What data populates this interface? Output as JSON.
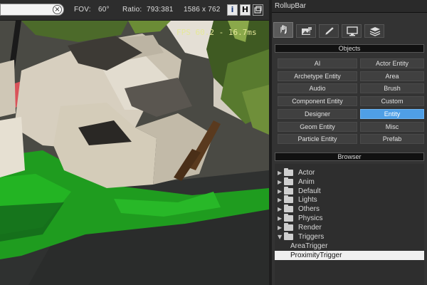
{
  "toolbar": {
    "search_value": "",
    "clear_icon": "×",
    "fov_label": "FOV:",
    "fov_value": "60°",
    "ratio_label": "Ratio:",
    "ratio_value": "793:381",
    "resolution": "1586 x 762",
    "info_button": "i",
    "h_button": "H",
    "icons": [
      "info-icon",
      "h-icon",
      "maximize-icon"
    ]
  },
  "viewport": {
    "fps_text": "FPS 60.2 - 16.7ms"
  },
  "rollup": {
    "title": "RollupBar",
    "tabs": [
      "objects-tab-icon",
      "terrain-tab-icon",
      "modify-tab-icon",
      "display-tab-icon",
      "layers-tab-icon"
    ],
    "objects_header": "Objects",
    "buttons": [
      [
        "AI",
        "Actor Entity"
      ],
      [
        "Archetype Entity",
        "Area"
      ],
      [
        "Audio",
        "Brush"
      ],
      [
        "Component Entity",
        "Custom"
      ],
      [
        "Designer",
        "Entity"
      ],
      [
        "Geom Entity",
        "Misc"
      ],
      [
        "Particle Entity",
        "Prefab"
      ]
    ],
    "selected_button": "Entity",
    "browser_header": "Browser",
    "tree": [
      {
        "label": "Actor",
        "expanded": false
      },
      {
        "label": "Anim",
        "expanded": false
      },
      {
        "label": "Default",
        "expanded": false
      },
      {
        "label": "Lights",
        "expanded": false
      },
      {
        "label": "Others",
        "expanded": false
      },
      {
        "label": "Physics",
        "expanded": false
      },
      {
        "label": "Render",
        "expanded": false
      },
      {
        "label": "Triggers",
        "expanded": true
      }
    ],
    "tree_children": [
      "AreaTrigger",
      "ProximityTrigger"
    ],
    "selected_child": "ProximityTrigger"
  },
  "colors": {
    "accent": "#4f9fe6",
    "fps_text": "#e5e89a",
    "panel_bg": "#333333"
  }
}
